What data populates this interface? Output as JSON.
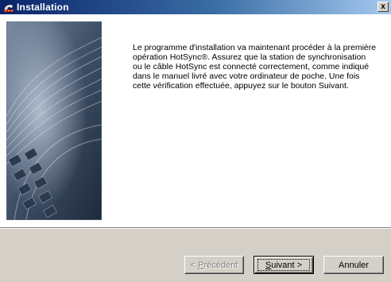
{
  "window": {
    "title": "Installation",
    "close_label": "x"
  },
  "content": {
    "line1": "Le programme d'installation va maintenant procéder à la première",
    "line2": "opération HotSync®. Assurez que la station de synchronisation",
    "line3": "ou le câble HotSync est connecté correctement, comme indiqué",
    "line4": "dans le manuel livré avec votre ordinateur de poche. Une fois",
    "line5": "cette vérification effectuée, appuyez sur le bouton Suivant."
  },
  "buttons": {
    "prev_mnemonic": "P",
    "prev_rest": "récédent",
    "prev_prefix": "< ",
    "next_mnemonic": "S",
    "next_rest": "uivant >",
    "cancel_label": "Annuler"
  },
  "colors": {
    "title_start": "#0a246a",
    "title_end": "#a6caf0",
    "dialog_bg": "#d4d0c8",
    "content_bg": "#ffffff"
  },
  "icons": {
    "title": "installer-icon",
    "close": "close-icon",
    "side": "wizard-side-image"
  }
}
